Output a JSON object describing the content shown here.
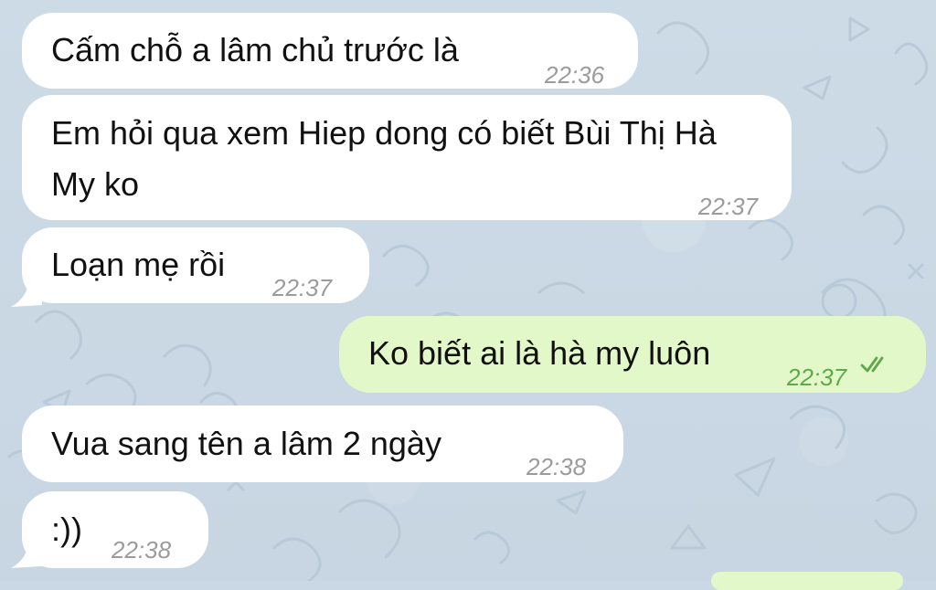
{
  "theme": {
    "background": "#c9d8e4",
    "incoming_bubble": "#ffffff",
    "outgoing_bubble": "#e3f8c9",
    "timestamp_gray": "#9b9b9b",
    "timestamp_green": "#5fa84b"
  },
  "messages": [
    {
      "direction": "incoming",
      "text": "Cấm chỗ a lâm chủ trước là",
      "time": "22:36"
    },
    {
      "direction": "incoming",
      "text": "Em hỏi qua xem Hiep dong có biết Bùi Thị Hà My ko",
      "time": "22:37"
    },
    {
      "direction": "incoming",
      "text": "Loạn mẹ rồi",
      "time": "22:37"
    },
    {
      "direction": "outgoing",
      "text": "Ko biết ai là hà my luôn",
      "time": "22:37",
      "status_icon": "double-check-icon"
    },
    {
      "direction": "incoming",
      "text": "Vua sang tên a lâm 2 ngày",
      "time": "22:38"
    },
    {
      "direction": "incoming",
      "text": ":))",
      "time": "22:38"
    }
  ]
}
